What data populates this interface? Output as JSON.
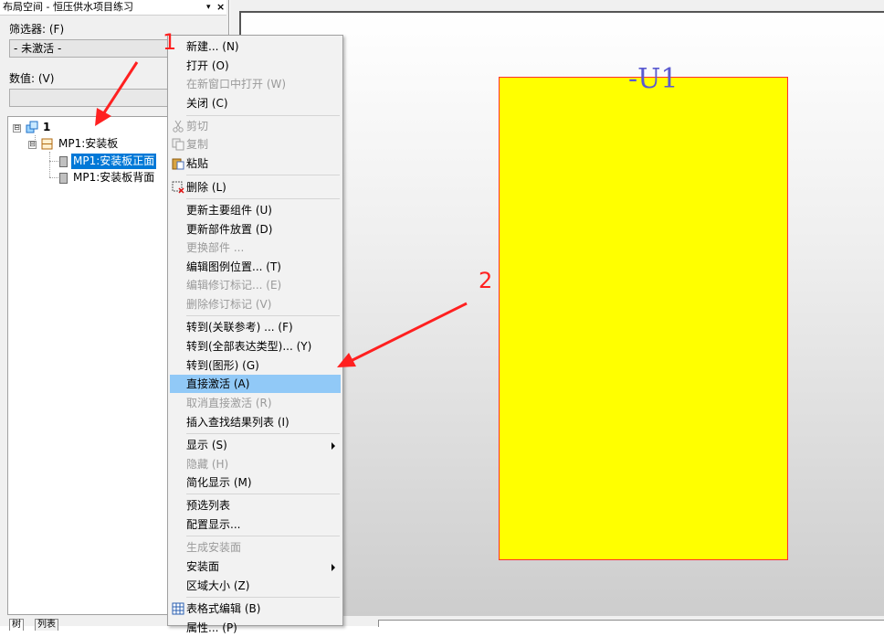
{
  "panel": {
    "title": "布局空间 - 恒压供水项目练习",
    "pin_glyph": "▾",
    "close_glyph": "×",
    "filter_label": "筛选器: (F)",
    "filter_value": "- 未激活 -",
    "value_label": "数值: (V)",
    "value_text": "",
    "tree": {
      "root": {
        "label": "1",
        "expander": "⊟"
      },
      "child": {
        "label": "MP1:安装板",
        "expander": "⊟"
      },
      "leaves": [
        {
          "label": "MP1:安装板正面",
          "selected": true
        },
        {
          "label": "MP1:安装板背面",
          "selected": false
        }
      ]
    },
    "tabs": [
      "树",
      "列表"
    ]
  },
  "workspace": {
    "plate_tag": "-U1",
    "plate_color": "#ffff00",
    "plate_border_color": "#ff3030"
  },
  "annotations": {
    "step1": "1",
    "step2": "2",
    "color": "#ff2020"
  },
  "menu": {
    "items": [
      {
        "label": "新建... (N)",
        "disabled": false
      },
      {
        "label": "打开 (O)",
        "disabled": false
      },
      {
        "label": "在新窗口中打开 (W)",
        "disabled": true
      },
      {
        "label": "关闭 (C)",
        "disabled": false
      },
      {
        "label": "剪切",
        "disabled": true,
        "icon": "scissors-icon"
      },
      {
        "label": "复制",
        "disabled": true,
        "icon": "copy-icon"
      },
      {
        "label": "粘贴",
        "disabled": false,
        "icon": "paste-icon"
      },
      {
        "label": "删除 (L)",
        "disabled": false,
        "icon": "delete-icon"
      },
      {
        "label": "更新主要组件 (U)",
        "disabled": false
      },
      {
        "label": "更新部件放置 (D)",
        "disabled": false
      },
      {
        "label": "更换部件 ...",
        "disabled": true
      },
      {
        "label": "编辑图例位置... (T)",
        "disabled": false
      },
      {
        "label": "编辑修订标记... (E)",
        "disabled": true
      },
      {
        "label": "删除修订标记 (V)",
        "disabled": true
      },
      {
        "label": "转到(关联参考) ... (F)",
        "disabled": false
      },
      {
        "label": "转到(全部表达类型)... (Y)",
        "disabled": false
      },
      {
        "label": "转到(图形) (G)",
        "disabled": false
      },
      {
        "label": "直接激活 (A)",
        "disabled": false,
        "highlighted": true
      },
      {
        "label": "取消直接激活 (R)",
        "disabled": true
      },
      {
        "label": "插入查找结果列表 (I)",
        "disabled": false
      },
      {
        "label": "显示 (S)",
        "disabled": false,
        "submenu": true
      },
      {
        "label": "隐藏 (H)",
        "disabled": true
      },
      {
        "label": "简化显示 (M)",
        "disabled": false
      },
      {
        "label": "预选列表",
        "disabled": false
      },
      {
        "label": "配置显示...",
        "disabled": false
      },
      {
        "label": "生成安装面",
        "disabled": true
      },
      {
        "label": "安装面",
        "disabled": false,
        "submenu": true
      },
      {
        "label": "区域大小 (Z)",
        "disabled": false
      },
      {
        "label": "表格式编辑 (B)",
        "disabled": false,
        "icon": "table-icon"
      },
      {
        "label": "属性... (P)",
        "disabled": false
      }
    ]
  }
}
